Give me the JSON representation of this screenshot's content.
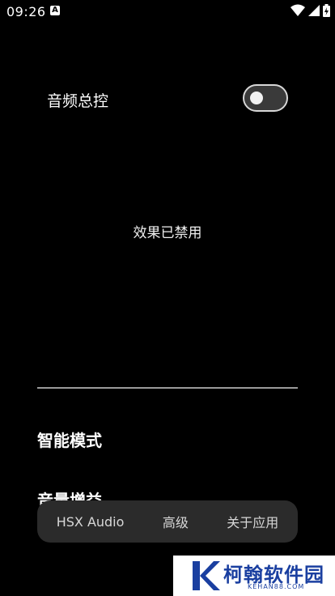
{
  "status_bar": {
    "time": "09:26",
    "notification_glyph": "A"
  },
  "master_switch": {
    "label": "音频总控",
    "enabled": false
  },
  "effects_status": "效果已禁用",
  "sections": {
    "smart_mode": "智能模式",
    "volume_gain": "音量增益"
  },
  "bottom_nav": {
    "tabs": [
      "HSX Audio",
      "高级",
      "关于应用"
    ]
  },
  "watermark": {
    "title": "柯翰软件园",
    "subtitle": "KEHAN88.COM",
    "color": "#1a3fa0"
  }
}
